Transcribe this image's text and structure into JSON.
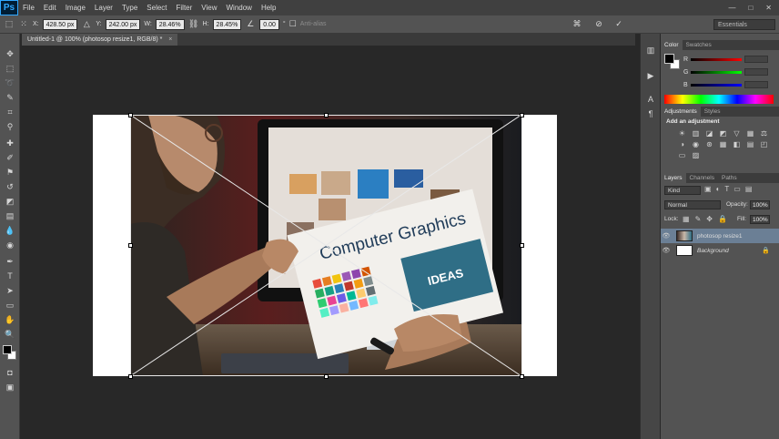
{
  "app": {
    "logo": "Ps"
  },
  "menu": [
    "File",
    "Edit",
    "Image",
    "Layer",
    "Type",
    "Select",
    "Filter",
    "View",
    "Window",
    "Help"
  ],
  "window_controls": {
    "minimize": "—",
    "maximize": "□",
    "close": "✕"
  },
  "options": {
    "x_label": "X:",
    "x_value": "428.50 px",
    "y_label": "Y:",
    "y_value": "242.00 px",
    "w_label": "W:",
    "w_value": "28.46%",
    "h_label": "H:",
    "h_value": "28.45%",
    "angle_value": "0.00",
    "angle_unit": "°",
    "antialias_label": "Anti-alias",
    "workspace": "Essentials"
  },
  "document": {
    "tab_title": "Untitled-1 @ 100% (photosop resize1, RGB/8) *",
    "tab_close": "×"
  },
  "photo": {
    "overlay_text": "Computer Graphics",
    "badge_text": "IDEAS"
  },
  "color_panel": {
    "tabs": [
      "Color",
      "Swatches"
    ],
    "channels": [
      "R",
      "G",
      "B"
    ]
  },
  "adjustments_panel": {
    "tabs": [
      "Adjustments",
      "Styles"
    ],
    "heading": "Add an adjustment"
  },
  "layers_panel": {
    "tabs": [
      "Layers",
      "Channels",
      "Paths"
    ],
    "kind_label": "Kind",
    "blend_mode": "Normal",
    "opacity_label": "Opacity:",
    "opacity_value": "100%",
    "lock_label": "Lock:",
    "fill_label": "Fill:",
    "fill_value": "100%",
    "layers": [
      {
        "name": "photosop resize1"
      },
      {
        "name": "Background"
      }
    ]
  },
  "colors": {
    "accent": "#31a8ff",
    "panel": "#535353",
    "canvas": "#282828"
  }
}
